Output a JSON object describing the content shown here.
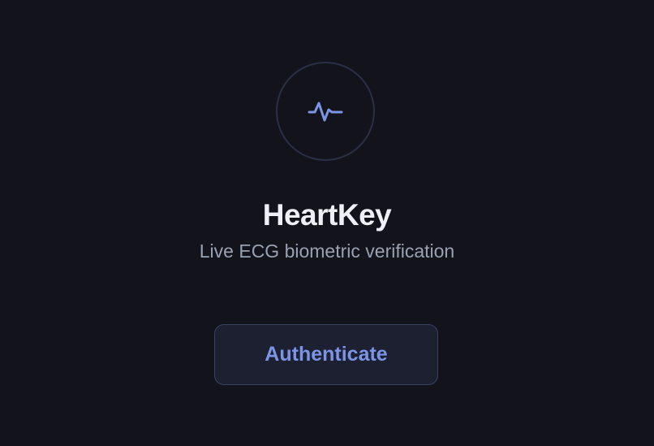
{
  "app": {
    "name": "HeartKey",
    "tagline": "Live ECG biometric verification"
  },
  "logo": {
    "icon": "ecg-pulse-icon"
  },
  "actions": {
    "authenticate_label": "Authenticate"
  },
  "colors": {
    "background": "#13141b",
    "accent": "#7b94e6",
    "title": "#eef0f6",
    "subtitle": "#9aa1b2",
    "ring_border": "#2a2f45",
    "button_bg": "#1c2030",
    "button_border": "#3a4261"
  }
}
